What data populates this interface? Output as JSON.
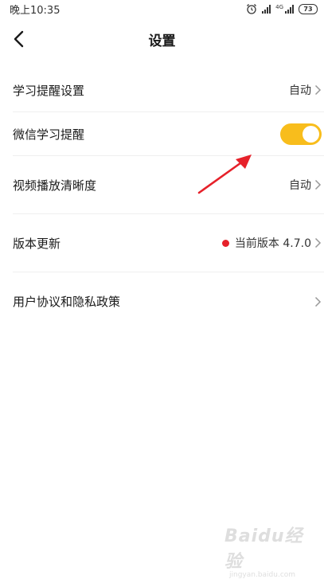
{
  "status_bar": {
    "time": "晚上10:35",
    "network_label": "4G",
    "battery": "73",
    "icons": [
      "alarm-icon",
      "signal-icon",
      "signal-4g-icon",
      "battery-icon"
    ]
  },
  "header": {
    "title": "设置",
    "back_icon": "chevron-left-icon"
  },
  "settings": {
    "items": [
      {
        "label": "学习提醒设置",
        "value": "自动",
        "control": "chevron"
      },
      {
        "label": "微信学习提醒",
        "value": "",
        "control": "toggle",
        "toggle_on": true
      },
      {
        "label": "视频播放清晰度",
        "value": "自动",
        "control": "chevron"
      },
      {
        "label": "版本更新",
        "value": "当前版本 4.7.0",
        "control": "chevron",
        "has_dot": true
      },
      {
        "label": "用户协议和隐私政策",
        "value": "",
        "control": "chevron"
      }
    ]
  },
  "colors": {
    "toggle_on": "#f8bd1c",
    "update_dot": "#e6212a",
    "annotation_arrow": "#e6212a"
  },
  "watermark": {
    "logo": "Baidu经验",
    "sub": "jingyan.baidu.com"
  }
}
